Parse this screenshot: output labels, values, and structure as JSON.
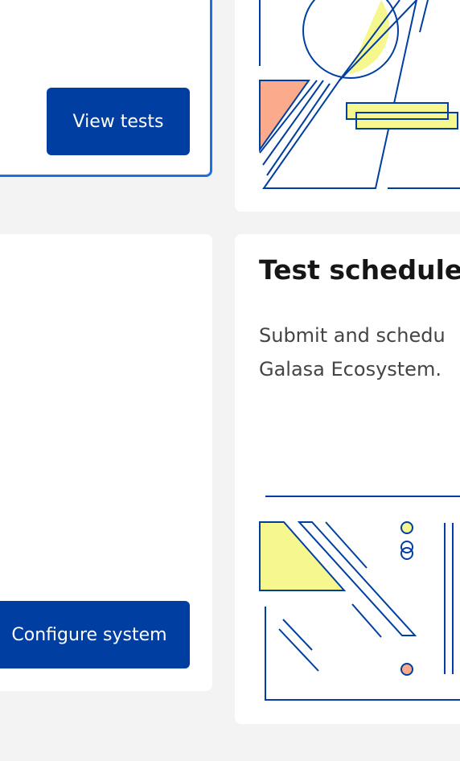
{
  "cards": {
    "test_runs": {
      "button_label": "View tests"
    },
    "config": {
      "button_label": "Configure system"
    },
    "test_schedule": {
      "title": "Test schedule",
      "description": "Submit and schedu\nGalasa Ecosystem."
    }
  },
  "colors": {
    "page_bg": "#f3f3f3",
    "card_bg": "#ffffff",
    "primary_button": "#003fa1",
    "focus_border": "#1e6fe0",
    "line_art": "#003fa1",
    "yellow_accent": "#f7f78f",
    "salmon_accent": "#fbab8c"
  },
  "icons": [
    "test-runs-illustration",
    "test-schedule-illustration"
  ]
}
